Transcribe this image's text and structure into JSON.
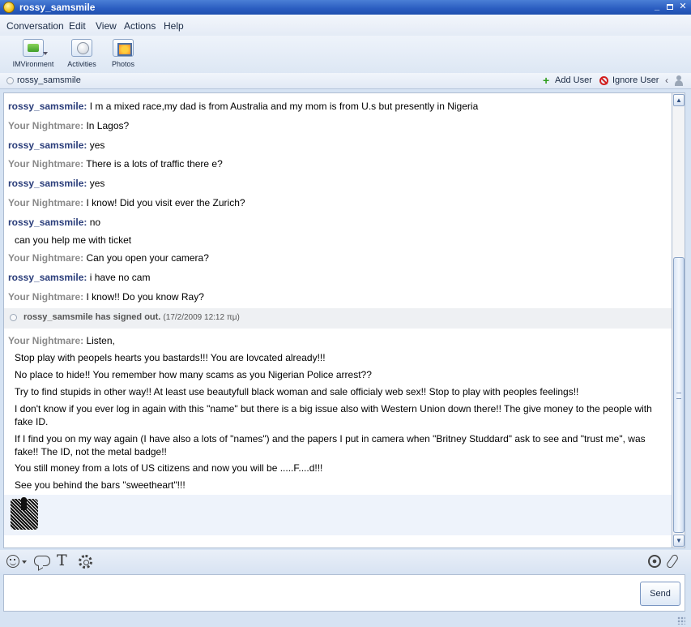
{
  "window": {
    "title": "rossy_samsmile",
    "minimize": "_",
    "close": "✕"
  },
  "menu": [
    "Conversation",
    "Edit",
    "View",
    "Actions",
    "Help"
  ],
  "toolbar": {
    "imvironment": "IMVironment",
    "activities": "Activities",
    "photos": "Photos"
  },
  "contact": {
    "name": "rossy_samsmile",
    "add_user": "Add User",
    "ignore_user": "Ignore User"
  },
  "messages": [
    {
      "sender": "rossy_samsmile:",
      "text": "I m a mixed race,my dad is from Australia and my mom is from U.s but presently in Nigeria"
    },
    {
      "sender": "Your Nightmare:",
      "text": "In Lagos?"
    },
    {
      "sender": "rossy_samsmile:",
      "text": "yes"
    },
    {
      "sender": "Your Nightmare:",
      "text": "There is a lots of traffic there e?"
    },
    {
      "sender": "rossy_samsmile:",
      "text": "yes"
    },
    {
      "sender": "Your Nightmare:",
      "text": "I know! Did you visit ever the Zurich?"
    },
    {
      "sender": "rossy_samsmile:",
      "text": "no"
    },
    {
      "text": "can you help me with ticket"
    },
    {
      "sender": "Your Nightmare:",
      "text": "Can you open your camera?"
    },
    {
      "sender": "rossy_samsmile:",
      "text": "i have no cam"
    },
    {
      "sender": "Your Nightmare:",
      "text": "I know!! Do you know Ray?"
    }
  ],
  "signout": {
    "text": "rossy_samsmile has signed out.",
    "time": "(17/2/2009 12:12 πμ)"
  },
  "after_messages": [
    {
      "sender": "Your Nightmare:",
      "text": "Listen,"
    },
    {
      "text": "Stop play with peopels hearts you bastards!!! You are lovcated already!!!"
    },
    {
      "text": "No place to hide!! You remember how many scams as you Nigerian Police arrest??"
    },
    {
      "text": "Try to find stupids in other way!! At least use beautyfull black woman and sale officialy web sex!! Stop to play with peoples feelings!!"
    },
    {
      "text": "I don't know if you ever log in again with this \"name\" but there is a big issue also with Western Union down there!! The give money to the people with fake ID."
    },
    {
      "text": "If I find you on my way again (I have also a lots of \"names\") and the papers I put in camera when \"Britney Studdard\" ask to see and \"trust me\", was fake!! The ID, not the metal badge!!"
    },
    {
      "text": "You still money from a lots of US citizens and now you will be .....F....d!!!"
    },
    {
      "text": "See you behind the bars \"sweetheart\"!!!"
    }
  ],
  "input": {
    "send_label": "Send",
    "text_icon": "T"
  },
  "icons": {
    "app": "messenger-smiley-icon",
    "imvironment": "imvironment-icon",
    "activities": "activities-icon",
    "photos": "photos-icon",
    "status": "status-dot-icon",
    "add": "plus-icon",
    "ignore": "block-icon",
    "emote": "middle-finger-emoticon-icon",
    "smiley": "smiley-icon",
    "bubble": "speech-bubble-icon",
    "text": "text-format-icon",
    "settings": "gear-icon",
    "webcam": "webcam-icon",
    "attach": "paperclip-icon"
  },
  "colors": {
    "titlebar": "#2a5cc0",
    "rossy_name": "#2a3d7a",
    "your_name": "#8a8a8a",
    "add_green": "#2f9e1d",
    "ignore_red": "#d21e1e"
  }
}
